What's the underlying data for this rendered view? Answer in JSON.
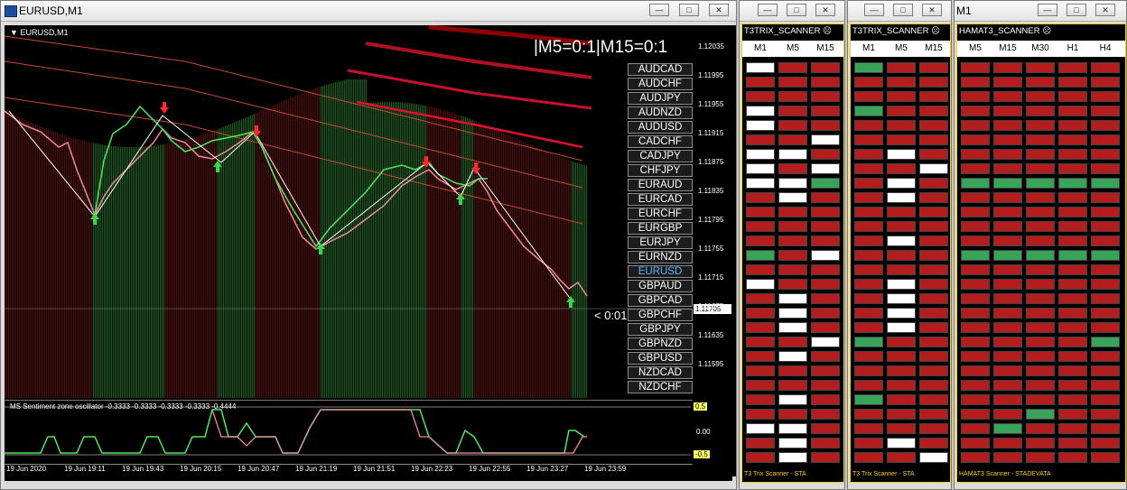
{
  "main_window": {
    "title": "EURUSD,M1",
    "chart_label": "EURUSD,M1",
    "signal_text": "|M5=0:1|M15=0:1",
    "countdown": "< 0:01",
    "current_price": "1.11705",
    "price_levels": [
      "1.12035",
      "1.11995",
      "1.11955",
      "1.11915",
      "1.11875",
      "1.11835",
      "1.11795",
      "1.11755",
      "1.11715",
      "1.11675",
      "1.11635",
      "1.11595"
    ],
    "time_labels": [
      "19 Jun 2020",
      "19 Jun 19:11",
      "19 Jun 19:43",
      "19 Jun 20:15",
      "19 Jun 20:47",
      "19 Jun 21:19",
      "19 Jun 21:51",
      "19 Jun 22:23",
      "19 Jun 22:55",
      "19 Jun 23:27",
      "19 Jun 23:59"
    ],
    "symbols": [
      "AUDCAD",
      "AUDCHF",
      "AUDJPY",
      "AUDNZD",
      "AUDUSD",
      "CADCHF",
      "CADJPY",
      "CHFJPY",
      "EURAUD",
      "EURCAD",
      "EURCHF",
      "EURGBP",
      "EURJPY",
      "EURNZD",
      "EURUSD",
      "GBPAUD",
      "GBPCAD",
      "GBPCHF",
      "GBPJPY",
      "GBPNZD",
      "GBPUSD",
      "NZDCAD",
      "NZDCHF"
    ],
    "active_symbol": "EURUSD",
    "oscillator": {
      "label": "MS Sentiment zone oscillator -0.3333 -0.3333 -0.3333 -0.3333 -0.4444",
      "upper": "0.5",
      "mid": "0.00",
      "lower": "-0.5"
    }
  },
  "scanner1": {
    "window_title": "",
    "title": "T3TRIX_SCANNER",
    "columns": [
      "M1",
      "M5",
      "M15"
    ],
    "footer": "T3 Trix Scanner - STA"
  },
  "scanner2": {
    "window_title": "",
    "title": "T3TRIX_SCANNER",
    "columns": [
      "M1",
      "M5",
      "M15"
    ],
    "footer": "T3 Trix Scanner - STA"
  },
  "scanner3": {
    "window_title": "M1",
    "title": "HAMAT3_SCANNER",
    "columns": [
      "M5",
      "M15",
      "M30",
      "H1",
      "H4"
    ],
    "footer": "HAMAT3 Scanner - STADEVATA"
  },
  "colors": {
    "bull": "#3aa35a",
    "bear": "#b31d1d",
    "neutral": "#ffffff",
    "active_symbol": "#5ab4ff",
    "scanner_border": "#ffd200"
  }
}
